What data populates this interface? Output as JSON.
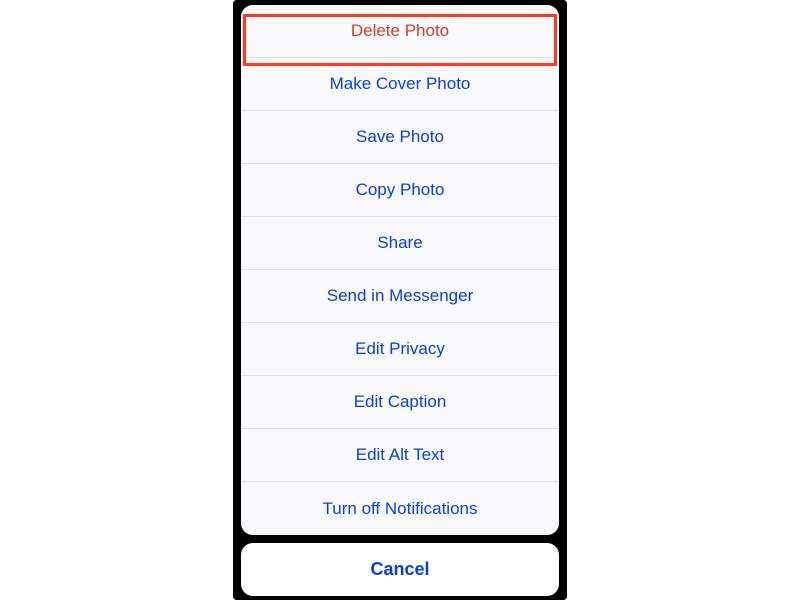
{
  "actions": {
    "0": {
      "label": "Delete Photo"
    },
    "1": {
      "label": "Make Cover Photo"
    },
    "2": {
      "label": "Save Photo"
    },
    "3": {
      "label": "Copy Photo"
    },
    "4": {
      "label": "Share"
    },
    "5": {
      "label": "Send in Messenger"
    },
    "6": {
      "label": "Edit Privacy"
    },
    "7": {
      "label": "Edit Caption"
    },
    "8": {
      "label": "Edit Alt Text"
    },
    "9": {
      "label": "Turn off Notifications"
    }
  },
  "cancel_label": "Cancel",
  "highlight": {
    "target": "delete-photo"
  },
  "colors": {
    "link": "#0a3fde",
    "destructive": "#d83a2f",
    "highlight_border": "#ff3b1f"
  }
}
